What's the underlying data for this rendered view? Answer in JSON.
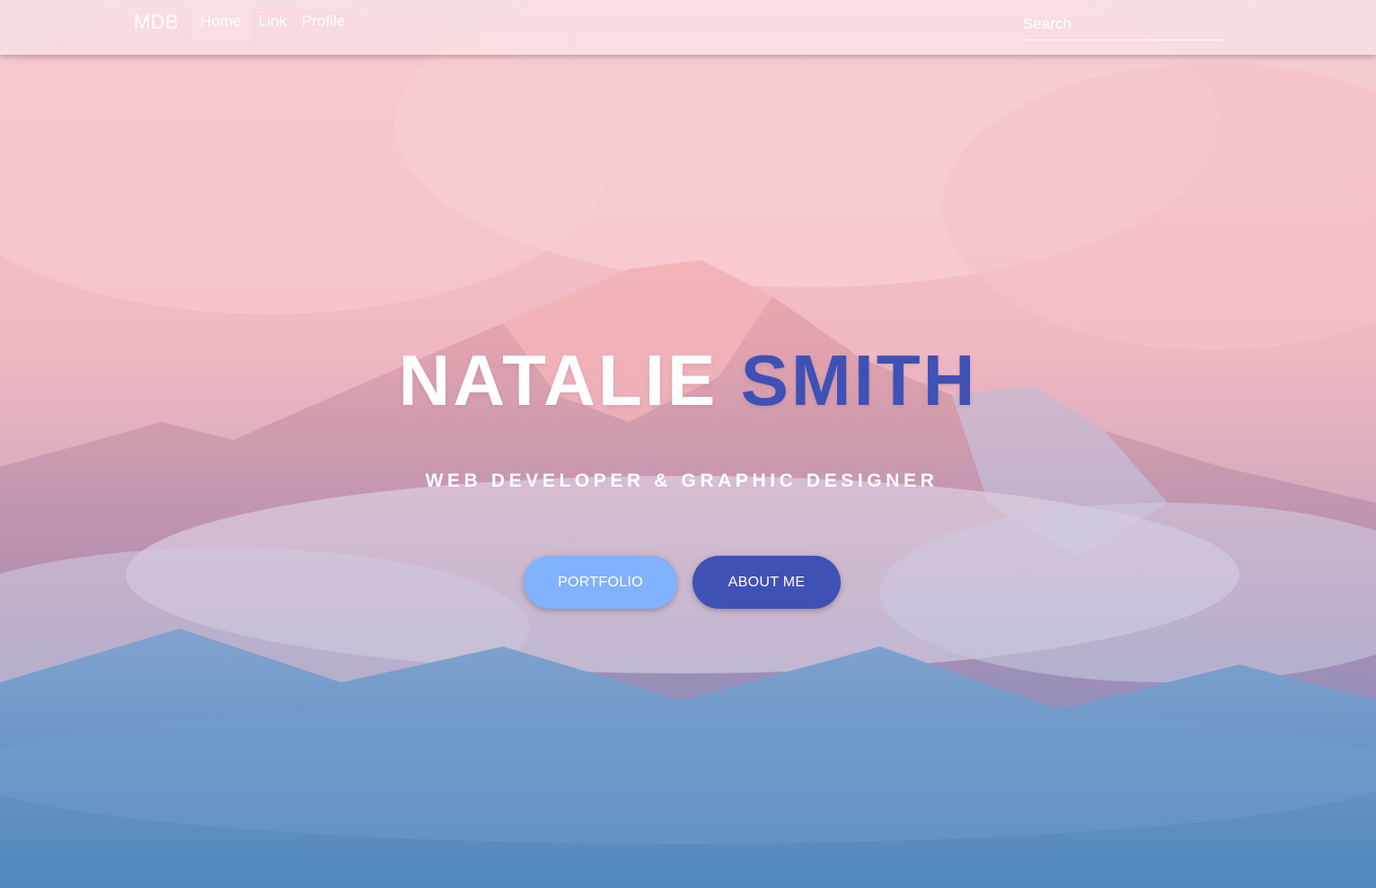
{
  "navbar": {
    "brand": "MDB",
    "links": [
      {
        "label": "Home"
      },
      {
        "label": "Link"
      },
      {
        "label": "Profile"
      }
    ],
    "search": {
      "placeholder": "Search",
      "value": ""
    }
  },
  "hero": {
    "first_name": "NATALIE",
    "last_name": "SMITH",
    "subtitle": "WEB DEVELOPER & GRAPHIC DESIGNER",
    "buttons": [
      {
        "label": "PORTFOLIO"
      },
      {
        "label": "ABOUT ME"
      }
    ]
  },
  "colors": {
    "primary": "#3f51b5",
    "light_blue": "#82b1ff",
    "text": "#ffffff"
  },
  "background": {
    "image": "mountain-landscape"
  }
}
